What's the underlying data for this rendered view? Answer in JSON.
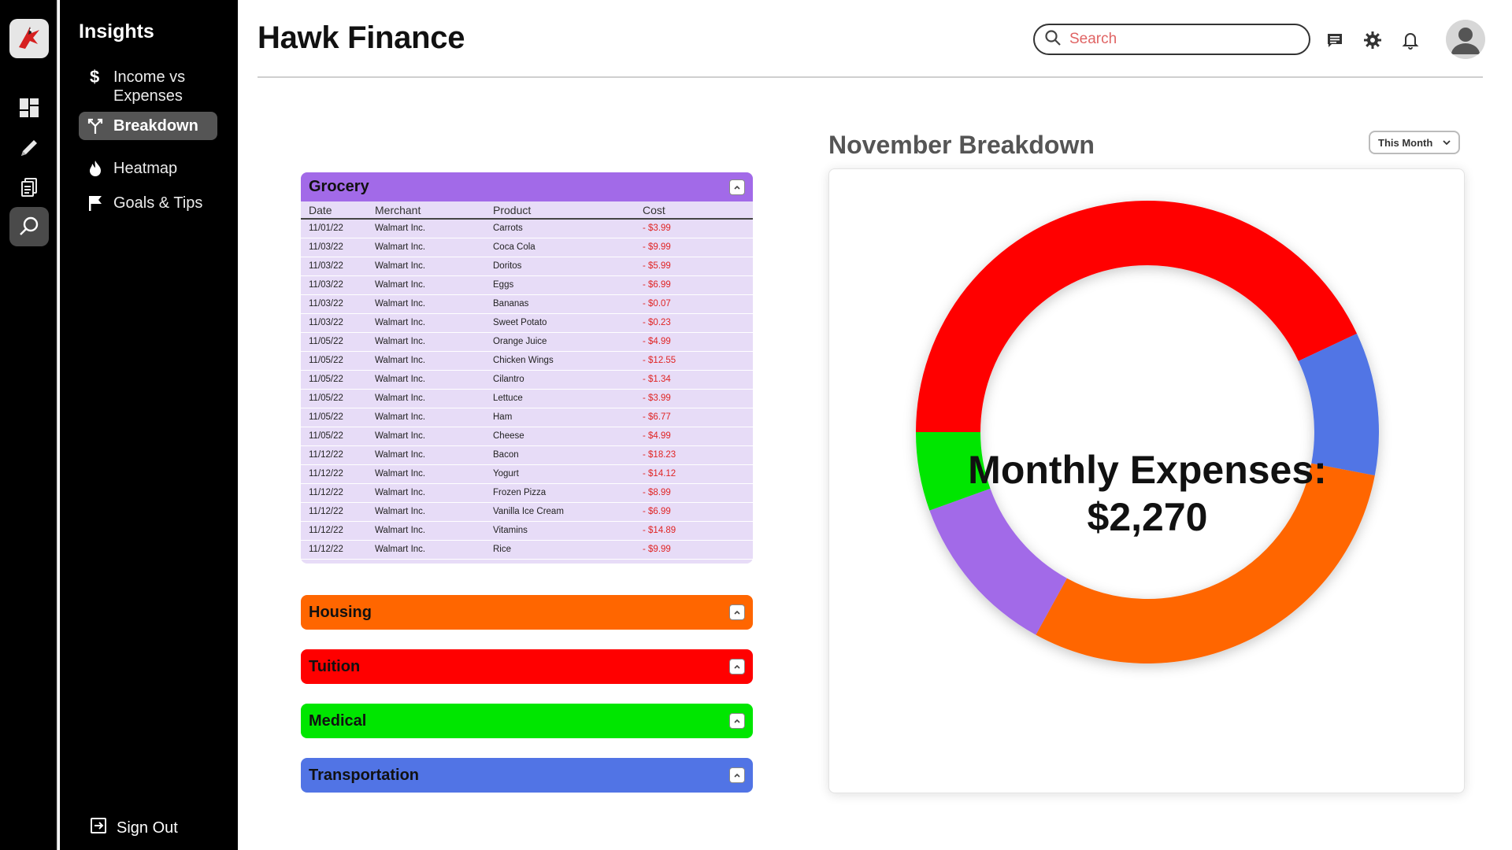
{
  "app": {
    "title": "Hawk Finance",
    "logo_icon": "hawk-logo-icon"
  },
  "rail": {
    "items": [
      {
        "icon": "dashboard-icon"
      },
      {
        "icon": "pencil-icon"
      },
      {
        "icon": "documents-icon"
      },
      {
        "icon": "insights-search-icon",
        "active": true
      }
    ]
  },
  "sidebar": {
    "title": "Insights",
    "items": [
      {
        "label": "Income vs Expenses",
        "icon": "dollar-icon"
      },
      {
        "label": "Breakdown",
        "icon": "split-arrows-icon",
        "active": true
      },
      {
        "label": "Heatmap",
        "icon": "flame-icon"
      },
      {
        "label": "Goals & Tips",
        "icon": "flag-icon"
      }
    ],
    "signout": "Sign Out"
  },
  "header": {
    "search_placeholder": "Search",
    "icons": [
      "chat-icon",
      "gear-icon",
      "bell-icon",
      "avatar"
    ]
  },
  "grocery": {
    "title": "Grocery",
    "color": "#a26ae8",
    "columns": [
      "Date",
      "Merchant",
      "Product",
      "Cost"
    ],
    "rows": [
      [
        "11/01/22",
        "Walmart Inc.",
        "Carrots",
        "- $3.99"
      ],
      [
        "11/03/22",
        "Walmart Inc.",
        "Coca Cola",
        "- $9.99"
      ],
      [
        "11/03/22",
        "Walmart Inc.",
        "Doritos",
        "- $5.99"
      ],
      [
        "11/03/22",
        "Walmart Inc.",
        "Eggs",
        "- $6.99"
      ],
      [
        "11/03/22",
        "Walmart Inc.",
        "Bananas",
        "- $0.07"
      ],
      [
        "11/03/22",
        "Walmart Inc.",
        "Sweet Potato",
        "- $0.23"
      ],
      [
        "11/05/22",
        "Walmart Inc.",
        "Orange Juice",
        "- $4.99"
      ],
      [
        "11/05/22",
        "Walmart Inc.",
        "Chicken Wings",
        "- $12.55"
      ],
      [
        "11/05/22",
        "Walmart Inc.",
        "Cilantro",
        "- $1.34"
      ],
      [
        "11/05/22",
        "Walmart Inc.",
        "Lettuce",
        "- $3.99"
      ],
      [
        "11/05/22",
        "Walmart Inc.",
        "Ham",
        "- $6.77"
      ],
      [
        "11/05/22",
        "Walmart Inc.",
        "Cheese",
        "- $4.99"
      ],
      [
        "11/12/22",
        "Walmart Inc.",
        "Bacon",
        "- $18.23"
      ],
      [
        "11/12/22",
        "Walmart Inc.",
        "Yogurt",
        "- $14.12"
      ],
      [
        "11/12/22",
        "Walmart Inc.",
        "Frozen Pizza",
        "- $8.99"
      ],
      [
        "11/12/22",
        "Walmart Inc.",
        "Vanilla Ice Cream",
        "- $6.99"
      ],
      [
        "11/12/22",
        "Walmart Inc.",
        "Vitamins",
        "- $14.89"
      ],
      [
        "11/12/22",
        "Walmart Inc.",
        "Rice",
        "- $9.99"
      ]
    ]
  },
  "categories": [
    {
      "title": "Housing",
      "color": "#ff6600"
    },
    {
      "title": "Tuition",
      "color": "#ff0000"
    },
    {
      "title": "Medical",
      "color": "#00e600"
    },
    {
      "title": "Transportation",
      "color": "#5174e5"
    }
  ],
  "breakdown": {
    "title": "November Breakdown",
    "period": "This Month",
    "center_line1": "Monthly Expenses:",
    "center_line2": "$2,270"
  },
  "chart_data": {
    "type": "pie",
    "donut": true,
    "slices": [
      {
        "category": "Tuition",
        "percent": 43.0,
        "color": "#ff0000"
      },
      {
        "category": "Transportation",
        "percent": 10.0,
        "color": "#5174e5"
      },
      {
        "category": "Housing",
        "percent": 30.0,
        "color": "#ff6600"
      },
      {
        "category": "Grocery",
        "percent": 11.5,
        "color": "#a26ae8"
      },
      {
        "category": "Medical",
        "percent": 5.5,
        "color": "#00e600"
      }
    ]
  }
}
